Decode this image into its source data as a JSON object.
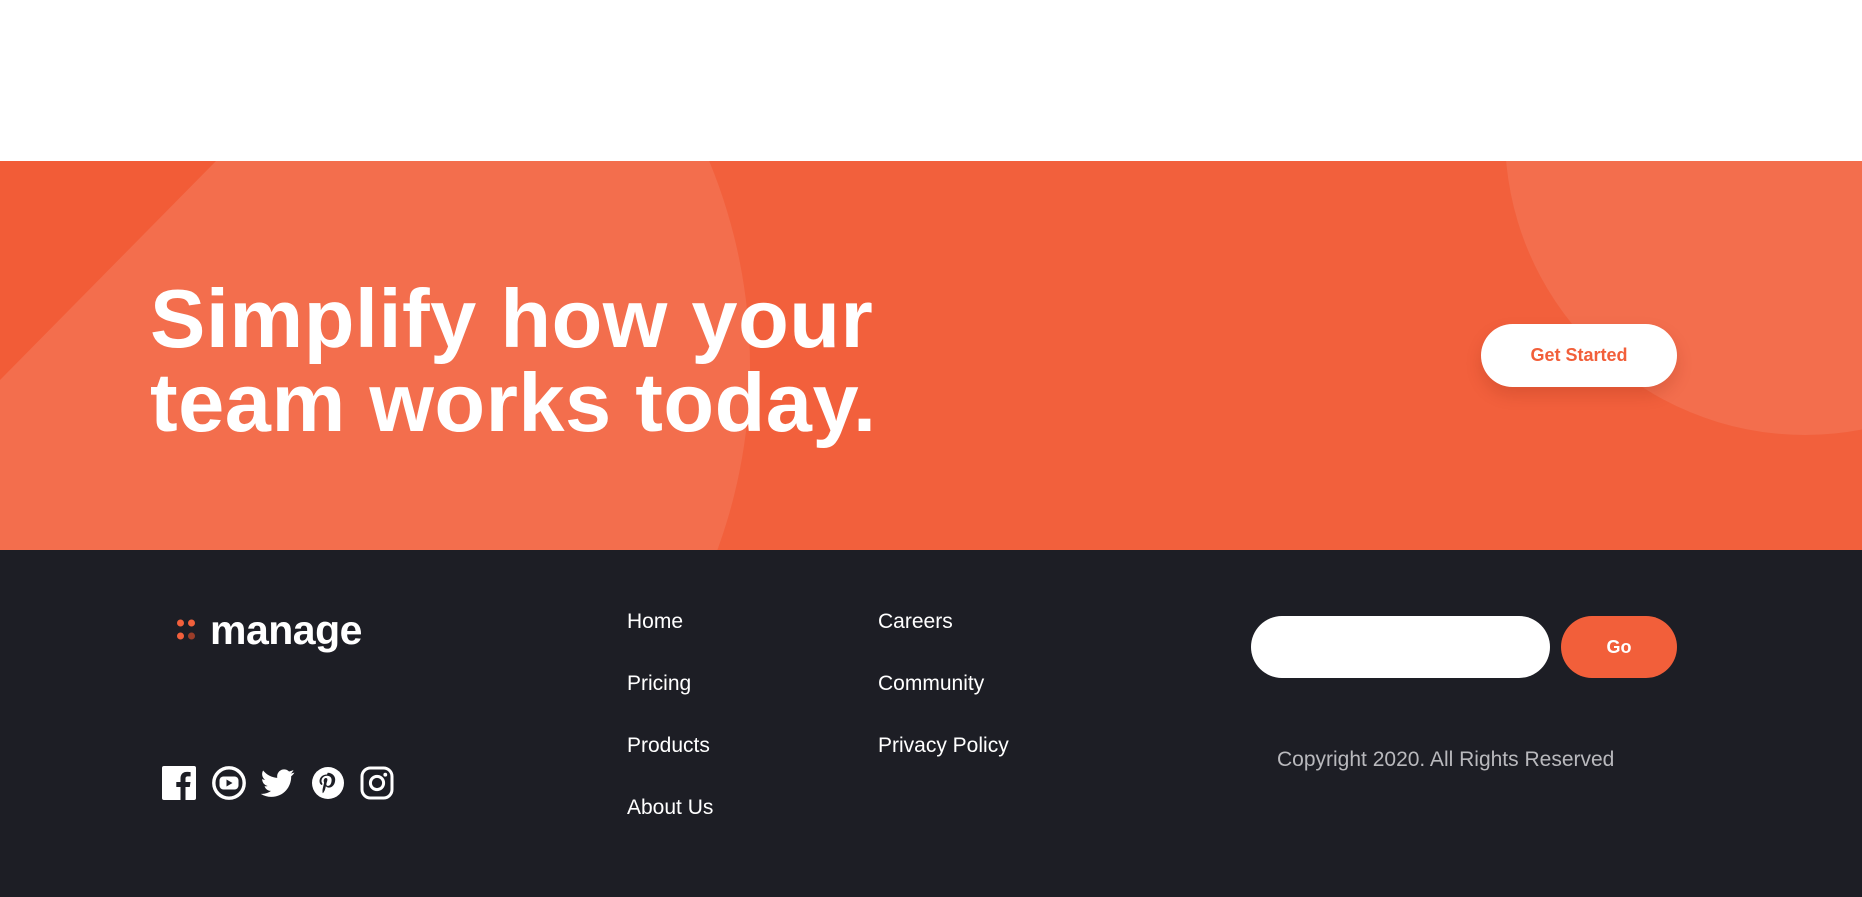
{
  "cta": {
    "title_line1": "Simplify how your",
    "title_line2": "team works today.",
    "get_started_label": "Get Started"
  },
  "footer": {
    "logo_text": "manage",
    "social_icons": [
      "facebook-icon",
      "youtube-icon",
      "twitter-icon",
      "pinterest-icon",
      "instagram-icon"
    ],
    "nav_col1": [
      "Home",
      "Pricing",
      "Products",
      "About Us"
    ],
    "nav_col2": [
      "Careers",
      "Community",
      "Privacy Policy"
    ],
    "newsletter_placeholder": "",
    "go_label": "Go",
    "copyright": "Copyright 2020. All Rights Reserved"
  },
  "colors": {
    "brand_orange": "#f2603c",
    "dark_bg": "#1d1e25",
    "white": "#ffffff",
    "muted_text": "#b9b9bd"
  }
}
